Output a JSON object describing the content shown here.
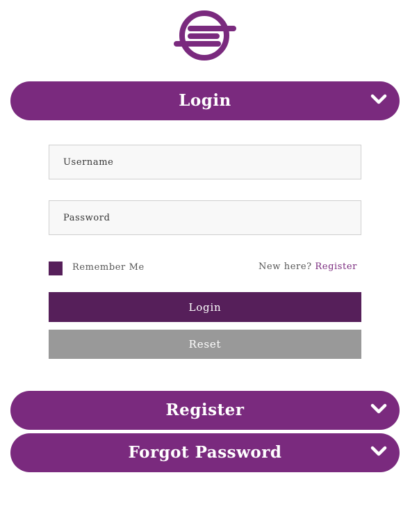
{
  "colors": {
    "accent": "#7a2a7e",
    "accent_dark": "#561f5a",
    "reset_gray": "#999999",
    "input_bg": "#f8f8f8"
  },
  "logo": {
    "icon": "brand-logo-icon"
  },
  "sections": {
    "login": {
      "title": "Login",
      "icon": "chevron-down-icon"
    },
    "register": {
      "title": "Register",
      "icon": "chevron-down-icon"
    },
    "forgot": {
      "title": "Forgot Password",
      "icon": "chevron-down-icon"
    }
  },
  "form": {
    "username_placeholder": "Username",
    "password_placeholder": "Password",
    "remember_label": "Remember Me",
    "new_here_text": "New here?",
    "register_link": "Register",
    "login_button": "Login",
    "reset_button": "Reset"
  }
}
